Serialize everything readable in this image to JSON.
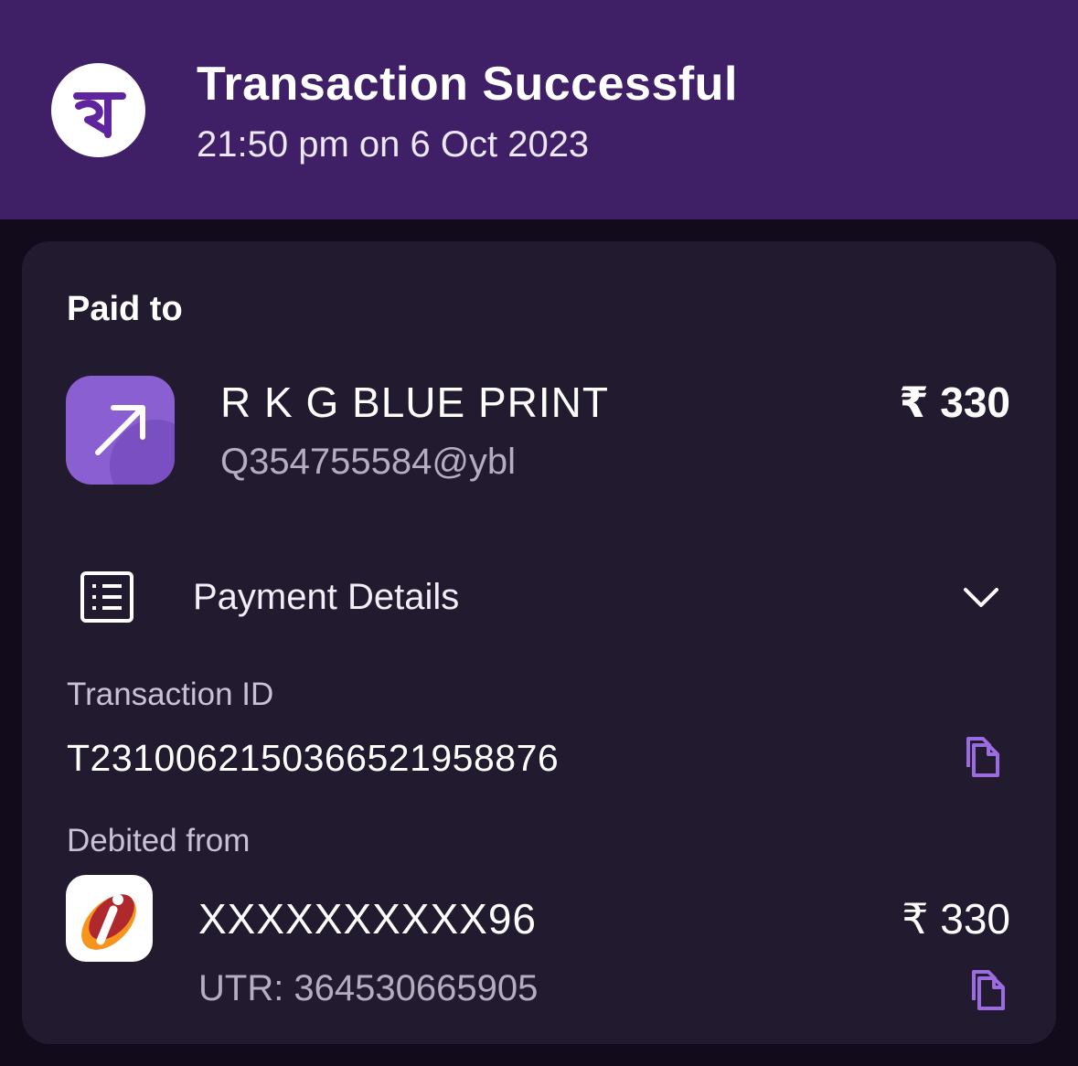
{
  "header": {
    "logo_icon": "phonepe-logo-icon",
    "title": "Transaction Successful",
    "timestamp": "21:50 pm on 6 Oct 2023",
    "background": "#3f1f66"
  },
  "paid_to": {
    "label": "Paid to",
    "icon": "arrow-up-right-icon",
    "name": "R K G BLUE PRINT",
    "upi_id": "Q354755584@ybl",
    "amount": "₹ 330"
  },
  "payment_details": {
    "icon": "receipt-list-icon",
    "label": "Payment Details",
    "toggle_icon": "chevron-down-icon"
  },
  "transaction": {
    "label": "Transaction ID",
    "id": "T2310062150366521958876",
    "copy_icon": "copy-icon"
  },
  "debited_from": {
    "label": "Debited from",
    "bank_icon": "icici-bank-icon",
    "account": "XXXXXXXXXX96",
    "amount": "₹ 330",
    "utr": "UTR: 364530665905",
    "copy_icon": "copy-icon"
  },
  "colors": {
    "accent": "#8a5fd1",
    "card": "#221a2f",
    "background": "#120b1c"
  }
}
